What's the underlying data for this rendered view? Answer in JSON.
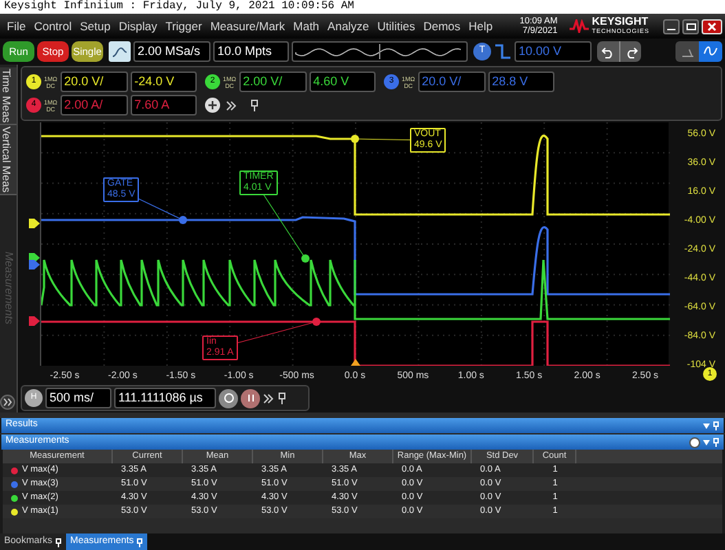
{
  "window": {
    "title": "Keysight Infiniium : Friday, July 9, 2021 10:09:56 AM"
  },
  "menu": [
    "File",
    "Control",
    "Setup",
    "Display",
    "Trigger",
    "Measure/Mark",
    "Math",
    "Analyze",
    "Utilities",
    "Demos",
    "Help"
  ],
  "clock": {
    "time": "10:09 AM",
    "date": "7/9/2021"
  },
  "logo": {
    "name": "KEYSIGHT",
    "sub": "TECHNOLOGIES"
  },
  "acquisition": {
    "buttons": [
      {
        "label": "Run",
        "color": "#2f9a2a"
      },
      {
        "label": "Stop",
        "color": "#d42020"
      },
      {
        "label": "Single",
        "color": "#a3a32c"
      }
    ],
    "sample_rate": "2.00 MSa/s",
    "memory_depth": "10.0 Mpts"
  },
  "trigger": {
    "badge": "T",
    "trigger_level": "10.00 V"
  },
  "side_tabs": [
    {
      "label": "Time Meas",
      "disabled": false
    },
    {
      "label": "Vertical Meas",
      "disabled": false
    },
    {
      "label": "Measurements",
      "disabled": true
    }
  ],
  "channels": [
    {
      "number": "1",
      "impedance": "1MΩ",
      "coupling": "DC",
      "scale": "20.0 V/",
      "offset": "-24.0 V",
      "color": "#e8e82a"
    },
    {
      "number": "2",
      "impedance": "1MΩ",
      "coupling": "DC",
      "scale": "2.00 V/",
      "offset": "4.60 V",
      "color": "#3ad83a"
    },
    {
      "number": "3",
      "impedance": "1MΩ",
      "coupling": "DC",
      "scale": "20.0 V/",
      "offset": "28.8 V",
      "color": "#3a6ee8"
    },
    {
      "number": "4",
      "impedance": "1MΩ",
      "coupling": "DC",
      "scale": "2.00 A/",
      "offset": "7.60 A",
      "color": "#e02040"
    }
  ],
  "plot": {
    "y_ticks": [
      "56.0 V",
      "36.0 V",
      "16.0 V",
      "-4.00 V",
      "-24.0 V",
      "-44.0 V",
      "-64.0 V",
      "-84.0 V",
      "-104 V"
    ],
    "x_ticks": [
      "-2.50 s",
      "-2.00 s",
      "-1.50 s",
      "-1.00 s",
      "-500 ms",
      "0.0 s",
      "500 ms",
      "1.00 s",
      "1.50 s",
      "2.00 s",
      "2.50 s"
    ],
    "labels": [
      {
        "name": "VOUT",
        "value": "49.6 V",
        "color": "#e8e82a"
      },
      {
        "name": "GATE",
        "value": "48.5 V",
        "color": "#3a6ee8"
      },
      {
        "name": "TIMER",
        "value": "4.01 V",
        "color": "#3ad83a"
      },
      {
        "name": "Iin",
        "value": "2.91 A",
        "color": "#e02040"
      }
    ],
    "trigger_badge": "1"
  },
  "horizontal": {
    "badge": "H",
    "scale": "500 ms/",
    "position": "111.1111086 µs"
  },
  "results": {
    "title": "Results"
  },
  "measurements": {
    "title": "Measurements",
    "columns": [
      "Measurement",
      "Current",
      "Mean",
      "Min",
      "Max",
      "Range (Max-Min)",
      "Std Dev",
      "Count"
    ],
    "rows": [
      {
        "color": "#e02040",
        "cells": [
          "V max(4)",
          "3.35 A",
          "3.35 A",
          "3.35 A",
          "3.35 A",
          "0.0 A",
          "0.0 A",
          "1"
        ]
      },
      {
        "color": "#3a6ee8",
        "cells": [
          "V max(3)",
          "51.0 V",
          "51.0 V",
          "51.0 V",
          "51.0 V",
          "0.0 V",
          "0.0 V",
          "1"
        ]
      },
      {
        "color": "#3ad83a",
        "cells": [
          "V max(2)",
          "4.30 V",
          "4.30 V",
          "4.30 V",
          "4.30 V",
          "0.0 V",
          "0.0 V",
          "1"
        ]
      },
      {
        "color": "#e8e82a",
        "cells": [
          "V max(1)",
          "53.0 V",
          "53.0 V",
          "53.0 V",
          "53.0 V",
          "0.0 V",
          "0.0 V",
          "1"
        ]
      }
    ]
  },
  "bottom_tabs": [
    {
      "label": "Bookmarks",
      "selected": false
    },
    {
      "label": "Measurements",
      "selected": true
    }
  ]
}
